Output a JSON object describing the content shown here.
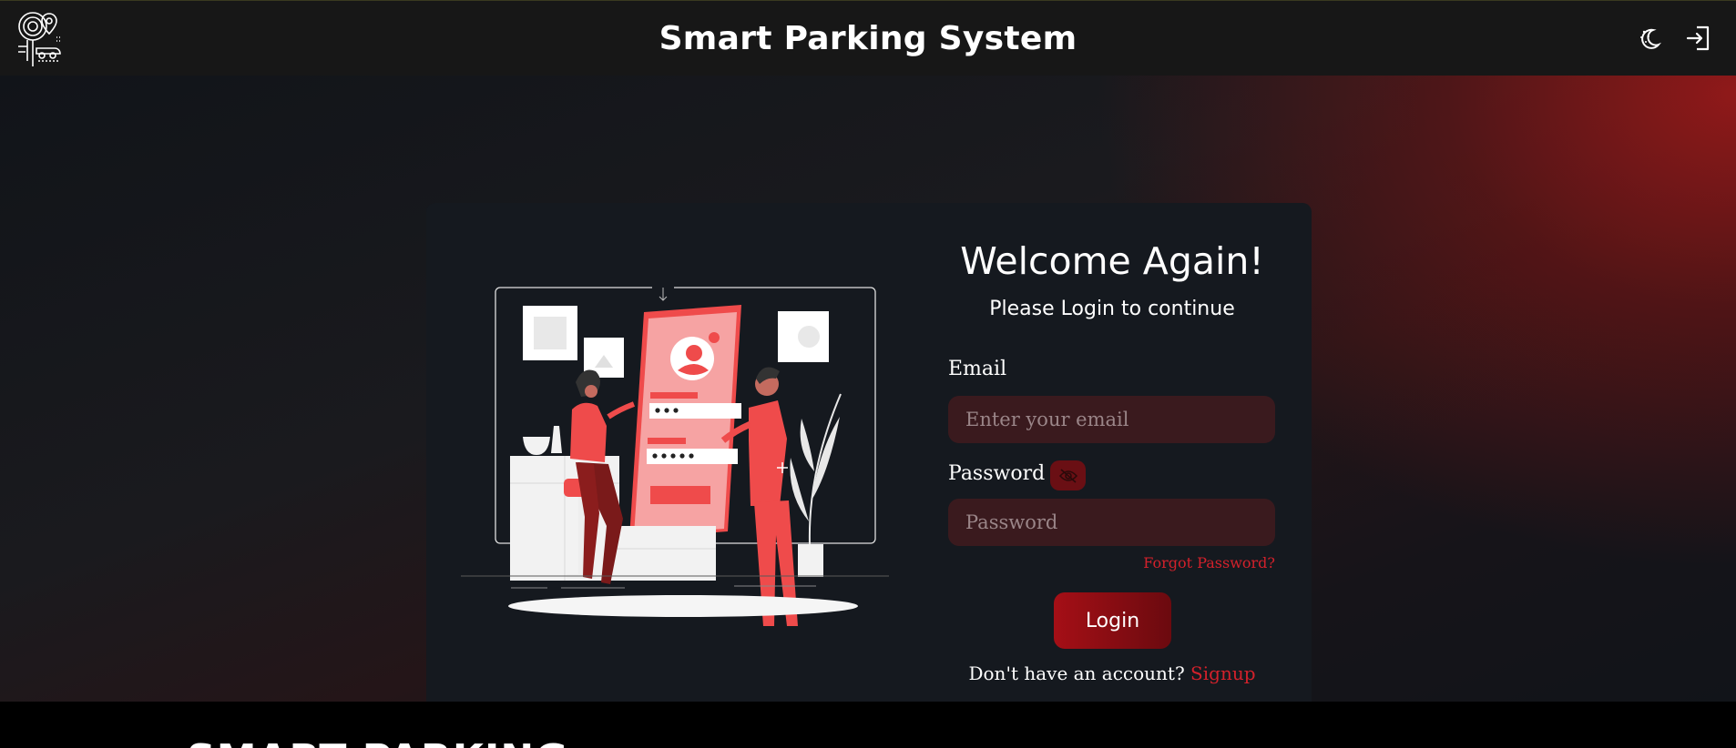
{
  "header": {
    "title": "Smart Parking System",
    "logo_icon": "parking-pin-logo-icon",
    "theme_icon": "moon-stars-icon",
    "login_icon": "sign-in-icon"
  },
  "login_card": {
    "illustration": "login-illustration",
    "welcome": "Welcome Again!",
    "subtitle": "Please Login to continue",
    "email_label": "Email",
    "email_placeholder": "Enter your email",
    "password_label": "Password",
    "password_placeholder": "Password",
    "password_toggle_icon": "eye-slash-icon",
    "forgot_password": "Forgot Password?",
    "login_button": "Login",
    "signup_prompt": "Don't have an account?",
    "signup_link": "Signup"
  },
  "footer": {
    "heading": "SMART PARKING"
  },
  "colors": {
    "accent": "#d3212b",
    "button_start": "#a50f16",
    "button_end": "#6b0a0f",
    "card": "#15191f",
    "topbar": "#171717"
  }
}
